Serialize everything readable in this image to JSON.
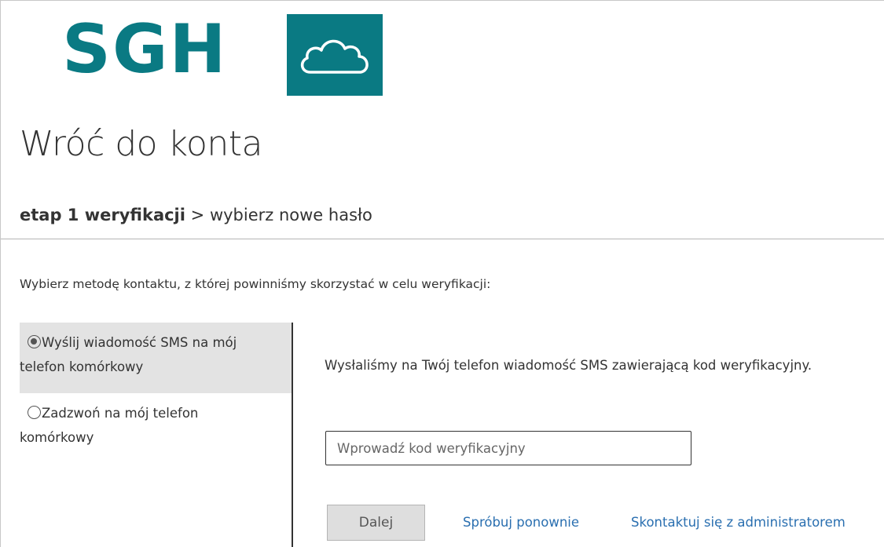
{
  "logo": {
    "text": "SGH",
    "icon": "cloud-icon",
    "brand_color": "#0a7a83"
  },
  "page_title": "Wróć do konta",
  "breadcrumb": {
    "current": "etap 1 weryfikacji",
    "separator": ">",
    "next": "wybierz nowe hasło"
  },
  "instruction": "Wybierz metodę kontaktu, z której powinniśmy skorzystać w celu weryfikacji:",
  "methods": [
    {
      "label_line1": "Wyślij wiadomość SMS na mój",
      "label_line2": "telefon komórkowy",
      "selected": true
    },
    {
      "label_line1": "Zadzwoń na mój telefon",
      "label_line2": "komórkowy",
      "selected": false
    }
  ],
  "detail": {
    "message": "Wysłaliśmy na Twój telefon wiadomość SMS zawierającą kod weryfikacyjny.",
    "input_placeholder": "Wprowadź kod weryfikacyjny",
    "input_value": ""
  },
  "actions": {
    "next_label": "Dalej",
    "retry_label": "Spróbuj ponownie",
    "contact_label": "Skontaktuj się z administratorem"
  },
  "colors": {
    "link": "#2a6fb0",
    "selected_bg": "#e3e3e3",
    "button_bg": "#dedede"
  }
}
